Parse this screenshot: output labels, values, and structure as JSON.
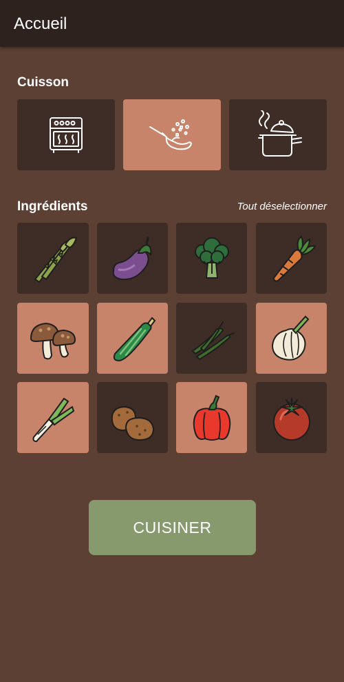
{
  "appbar": {
    "title": "Accueil"
  },
  "cooking": {
    "title": "Cuisson",
    "methods": [
      {
        "icon": "oven-icon",
        "selected": false
      },
      {
        "icon": "frying-pan-icon",
        "selected": true
      },
      {
        "icon": "boiling-pot-icon",
        "selected": false
      }
    ]
  },
  "ingredients": {
    "title": "Ingrédients",
    "deselect_label": "Tout déselectionner",
    "items": [
      {
        "icon": "asparagus-icon",
        "selected": false
      },
      {
        "icon": "eggplant-icon",
        "selected": false
      },
      {
        "icon": "broccoli-icon",
        "selected": false
      },
      {
        "icon": "carrot-icon",
        "selected": false
      },
      {
        "icon": "mushroom-icon",
        "selected": true
      },
      {
        "icon": "zucchini-icon",
        "selected": true
      },
      {
        "icon": "green-beans-icon",
        "selected": false
      },
      {
        "icon": "onion-icon",
        "selected": true
      },
      {
        "icon": "leek-icon",
        "selected": true
      },
      {
        "icon": "potato-icon",
        "selected": false
      },
      {
        "icon": "bell-pepper-icon",
        "selected": true
      },
      {
        "icon": "tomato-icon",
        "selected": false
      }
    ]
  },
  "cook_button": {
    "label": "CUISINER"
  },
  "colors": {
    "background": "#5d4034",
    "appbar": "#2e221f",
    "tile": "#3e2c26",
    "tile_selected": "#c8846a",
    "button": "#869a6e"
  }
}
